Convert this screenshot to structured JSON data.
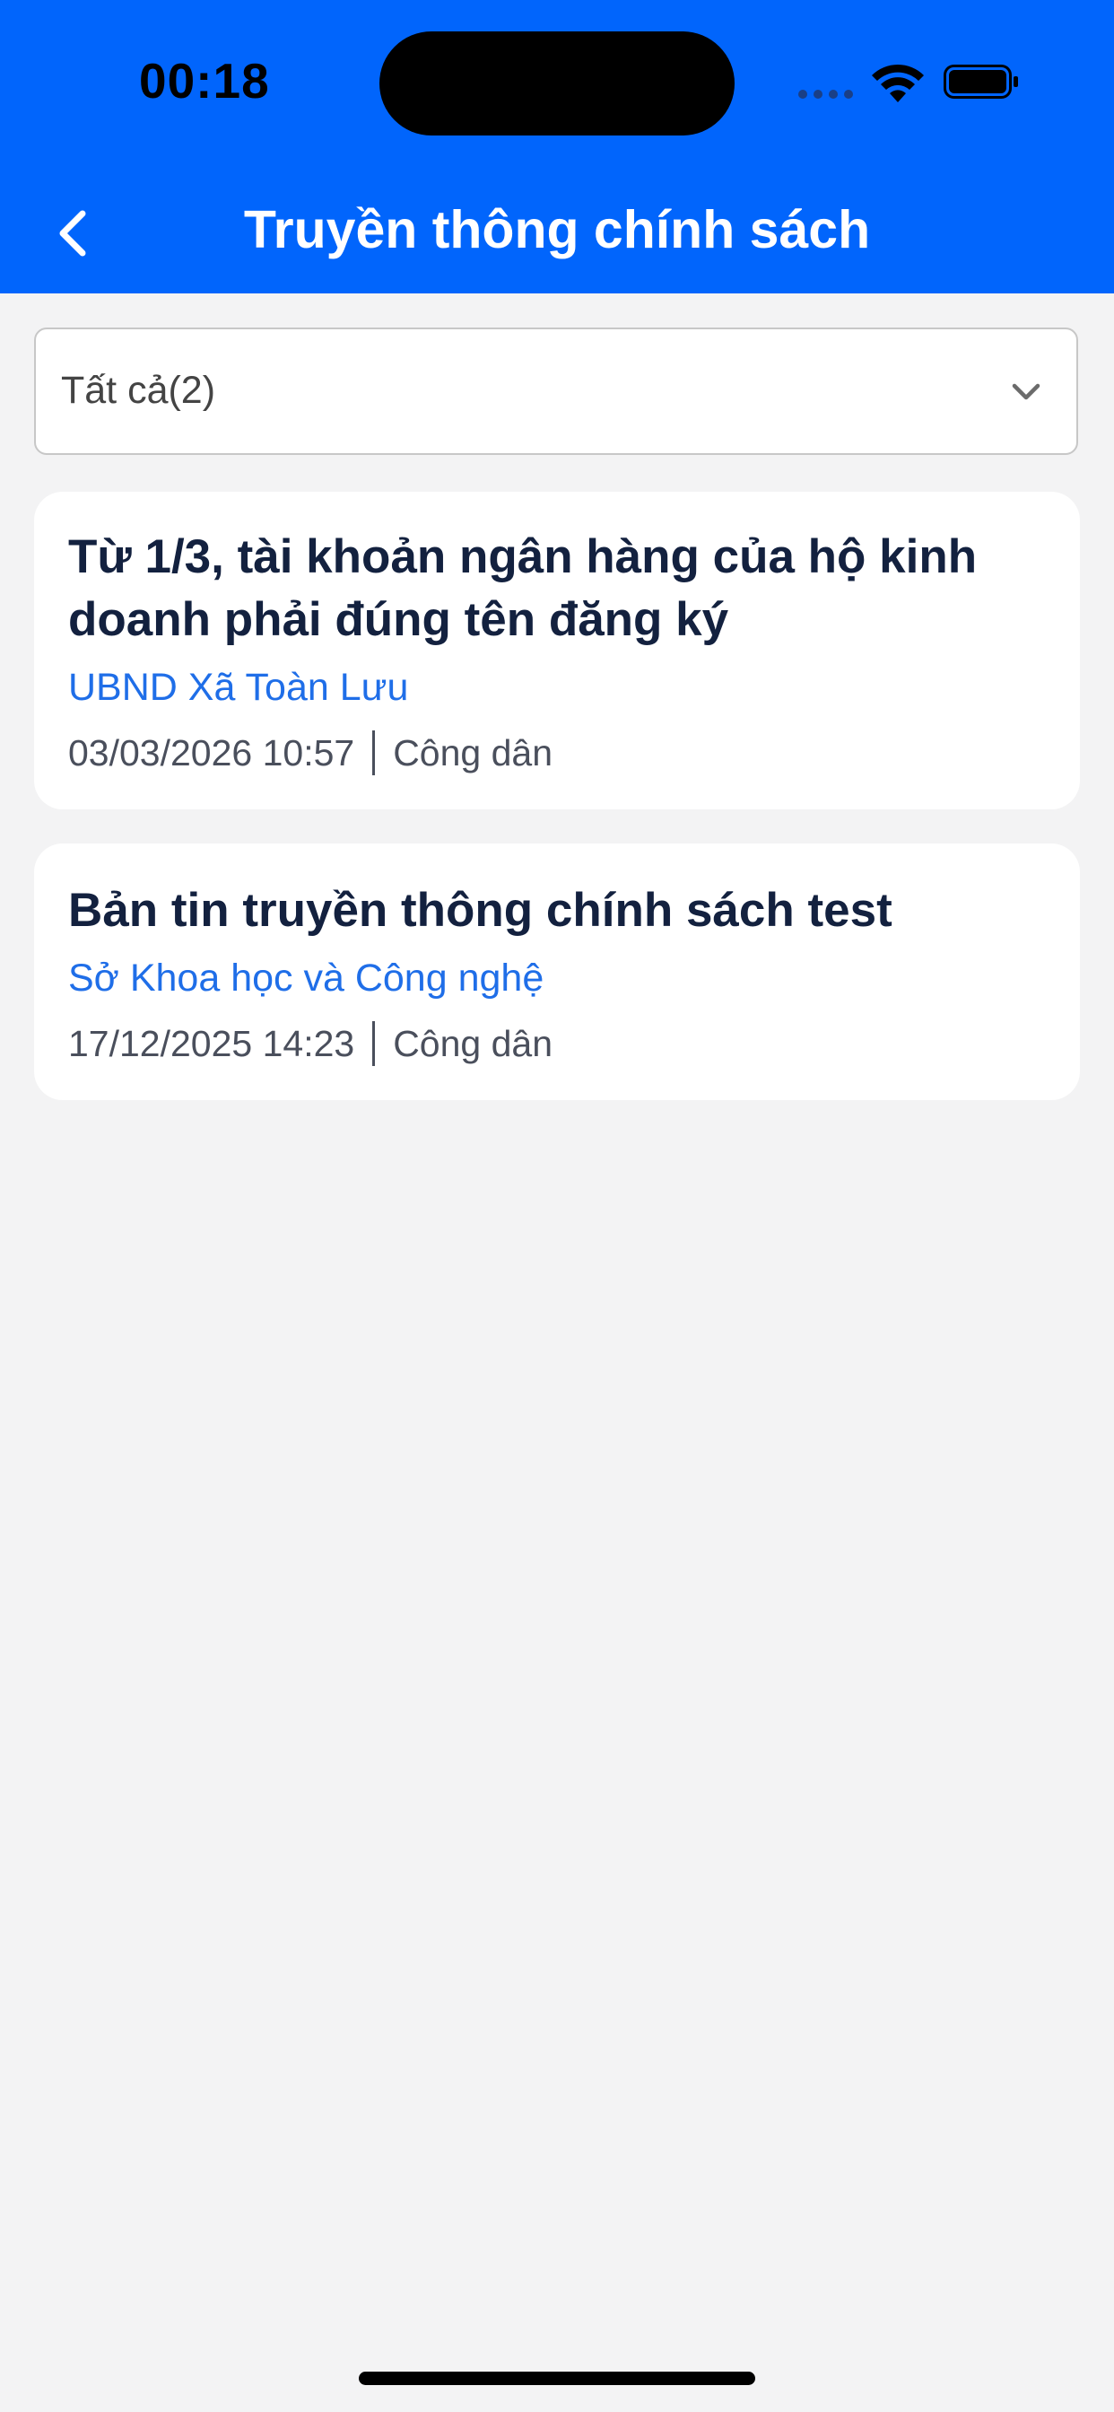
{
  "status_bar": {
    "time": "00:18"
  },
  "header": {
    "title": "Truyền thông chính sách",
    "back_icon": "chevron-left-icon",
    "background_color": "#0165fc"
  },
  "filter": {
    "selected": "Tất cả(2)",
    "chevron_icon": "chevron-down-icon"
  },
  "news": [
    {
      "title": "Từ 1/3, tài khoản ngân hàng của hộ kinh doanh phải đúng tên đăng ký",
      "organization": "UBND Xã Toàn Lưu",
      "datetime": "03/03/2026 10:57",
      "audience": "Công dân"
    },
    {
      "title": "Bản tin truyền thông chính sách test",
      "organization": "Sở Khoa học và Công nghệ",
      "datetime": "17/12/2025 14:23",
      "audience": "Công dân"
    }
  ],
  "colors": {
    "accent": "#0165fc",
    "organization_link": "#1f6ee8",
    "title_text": "#13213f",
    "page_background": "#f3f3f4"
  }
}
